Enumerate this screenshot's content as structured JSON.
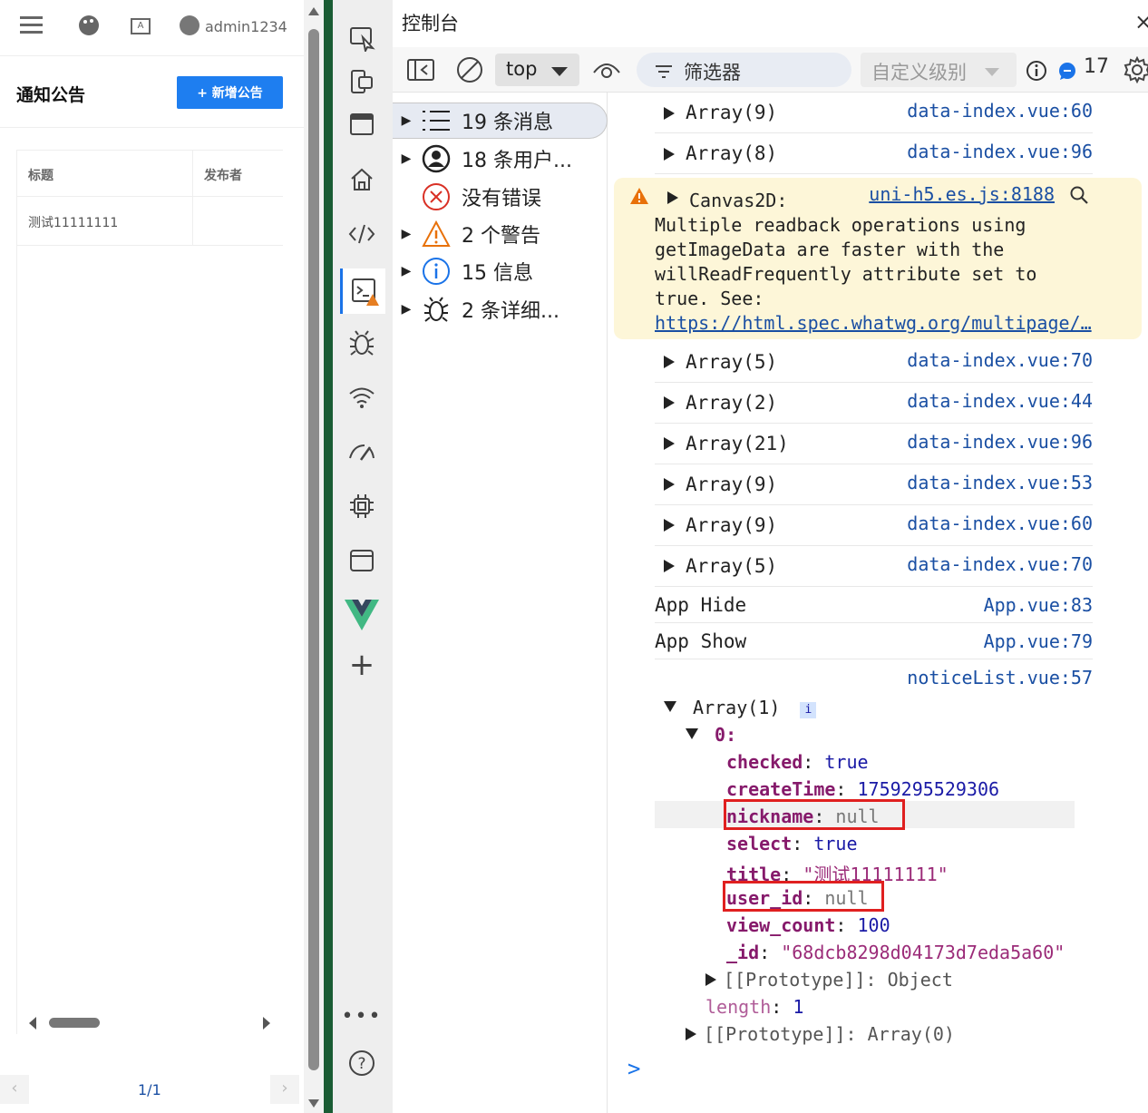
{
  "app": {
    "username": "admin1234",
    "page_title": "通知公告",
    "add_button": "+ 新增公告",
    "table": {
      "columns": [
        "标题",
        "发布者"
      ],
      "rows": [
        [
          "测试11111111",
          ""
        ]
      ]
    },
    "pager": "1/1"
  },
  "devtools": {
    "title": "控制台",
    "toolbar": {
      "context": "top",
      "filter_placeholder": "筛选器",
      "level": "自定义级别",
      "issues_count": "17"
    },
    "sidebar": [
      {
        "label": "19 条消息",
        "icon": "list-icon"
      },
      {
        "label": "18 条用户...",
        "icon": "user-icon"
      },
      {
        "label": "没有错误",
        "icon": "error-icon"
      },
      {
        "label": "2 个警告",
        "icon": "warning-icon"
      },
      {
        "label": "15 信息",
        "icon": "info-icon"
      },
      {
        "label": "2 条详细...",
        "icon": "bug-icon"
      }
    ],
    "logs_top": [
      {
        "text": "Array(9)",
        "src": "data-index.vue:60"
      },
      {
        "text": "Array(8)",
        "src": "data-index.vue:96"
      }
    ],
    "warning": {
      "title": "Canvas2D:",
      "message": "Multiple readback operations using\ngetImageData are faster with the\nwillReadFrequently attribute set to\ntrue. See:",
      "link": "https://html.spec.whatwg.org/multipage/…",
      "src": "uni-h5.es.js:8188"
    },
    "logs_mid": [
      {
        "text": "Array(5)",
        "src": "data-index.vue:70"
      },
      {
        "text": "Array(2)",
        "src": "data-index.vue:44"
      },
      {
        "text": "Array(21)",
        "src": "data-index.vue:96"
      },
      {
        "text": "Array(9)",
        "src": "data-index.vue:53"
      },
      {
        "text": "Array(9)",
        "src": "data-index.vue:60"
      },
      {
        "text": "Array(5)",
        "src": "data-index.vue:70"
      }
    ],
    "logs_plain": [
      {
        "text": "App Hide",
        "src": "App.vue:83"
      },
      {
        "text": "App Show",
        "src": "App.vue:79"
      },
      {
        "text": "",
        "src": "noticeList.vue:57"
      }
    ],
    "tree": {
      "root": "Array(1)",
      "index": "0:",
      "fields": [
        {
          "key": "checked",
          "value": "true",
          "type": "bool"
        },
        {
          "key": "createTime",
          "value": "1759295529306",
          "type": "num"
        },
        {
          "key": "nickname",
          "value": "null",
          "type": "null"
        },
        {
          "key": "select",
          "value": "true",
          "type": "bool"
        },
        {
          "key": "title",
          "value": "\"测试11111111\"",
          "type": "str"
        },
        {
          "key": "user_id",
          "value": "null",
          "type": "null"
        },
        {
          "key": "view_count",
          "value": "100",
          "type": "num"
        },
        {
          "key": "_id",
          "value": "\"68dcb8298d04173d7eda5a60\"",
          "type": "str"
        }
      ],
      "proto_object": "[[Prototype]]: Object",
      "length_key": "length",
      "length_value": "1",
      "proto_array": "[[Prototype]]: Array(0)"
    },
    "prompt": ">"
  }
}
